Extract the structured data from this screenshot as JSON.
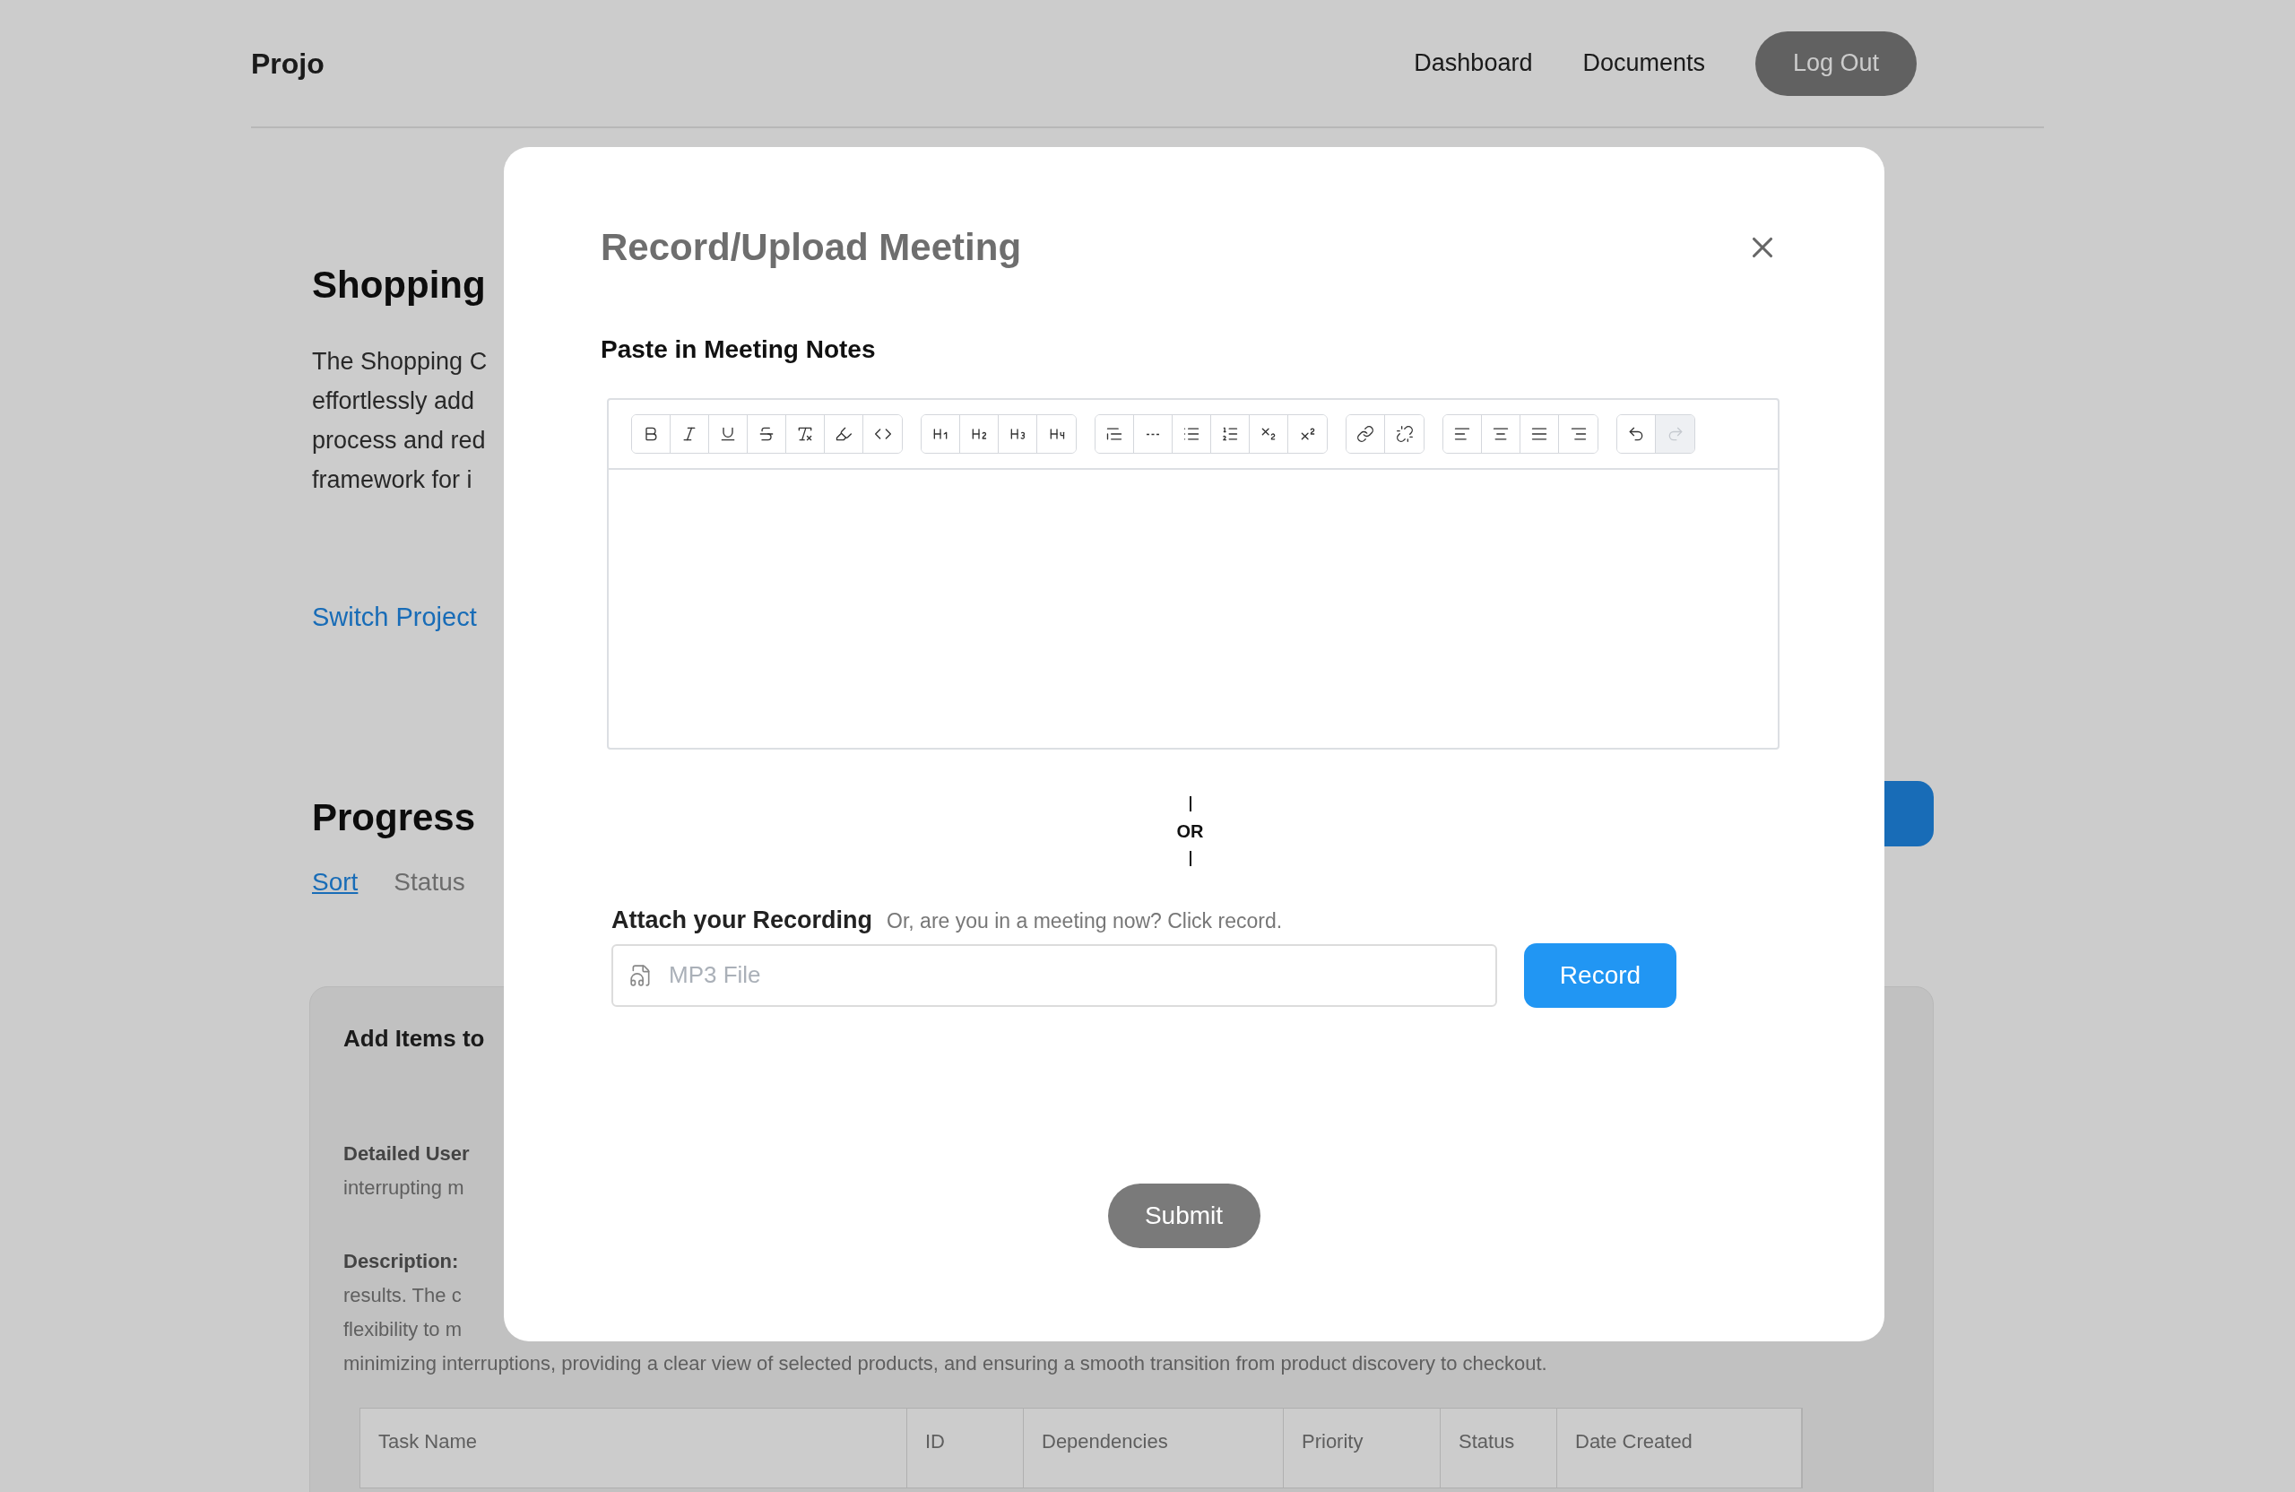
{
  "nav": {
    "brand": "Projo",
    "links": [
      "Dashboard",
      "Documents"
    ],
    "logout": "Log Out"
  },
  "page": {
    "title": "Shopping",
    "description_lines": [
      "The Shopping C",
      "effortlessly add",
      "process and red",
      "framework for i"
    ],
    "switch_link": "Switch Project",
    "progress_title": "Progress",
    "filters": [
      {
        "label": "Sort",
        "selected": true
      },
      {
        "label": "Status",
        "selected": false
      }
    ],
    "card": {
      "title": "Add Items to",
      "story_label": "Detailed User",
      "story_line": "interrupting m",
      "description_label": "Description:",
      "description_lines": [
        "results. The c",
        "flexibility to m",
        "minimizing interruptions, providing a clear view of selected products, and ensuring a smooth transition from product discovery to checkout."
      ],
      "table_columns": [
        "Task Name",
        "ID",
        "Dependencies",
        "Priority",
        "Status",
        "Date Created"
      ]
    }
  },
  "modal": {
    "title": "Record/Upload Meeting",
    "notes_label": "Paste in Meeting Notes",
    "toolbar": [
      [
        {
          "kind": "bold",
          "disabled": false
        },
        {
          "kind": "italic",
          "disabled": false
        },
        {
          "kind": "underline",
          "disabled": false
        },
        {
          "kind": "strike",
          "disabled": false
        },
        {
          "kind": "clear",
          "disabled": false
        },
        {
          "kind": "highlight",
          "disabled": false
        },
        {
          "kind": "code",
          "disabled": false
        }
      ],
      [
        {
          "kind": "h1",
          "disabled": false
        },
        {
          "kind": "h2",
          "disabled": false
        },
        {
          "kind": "h3",
          "disabled": false
        },
        {
          "kind": "h4",
          "disabled": false
        }
      ],
      [
        {
          "kind": "quote",
          "disabled": false
        },
        {
          "kind": "rule",
          "disabled": false
        },
        {
          "kind": "bullets",
          "disabled": false
        },
        {
          "kind": "numbers",
          "disabled": false
        },
        {
          "kind": "subscript",
          "disabled": false
        },
        {
          "kind": "superscript",
          "disabled": false
        }
      ],
      [
        {
          "kind": "link",
          "disabled": false
        },
        {
          "kind": "unlink",
          "disabled": false
        }
      ],
      [
        {
          "kind": "align-left",
          "disabled": false
        },
        {
          "kind": "align-center",
          "disabled": false
        },
        {
          "kind": "align-justify",
          "disabled": false
        },
        {
          "kind": "align-right",
          "disabled": false
        }
      ],
      [
        {
          "kind": "undo",
          "disabled": false
        },
        {
          "kind": "redo",
          "disabled": true
        }
      ]
    ],
    "divider_text": "OR",
    "attach_label": "Attach your Recording",
    "attach_hint": "Or, are you in a meeting now? Click record.",
    "file_placeholder": "MP3 File",
    "record_button": "Record",
    "submit_button": "Submit"
  }
}
